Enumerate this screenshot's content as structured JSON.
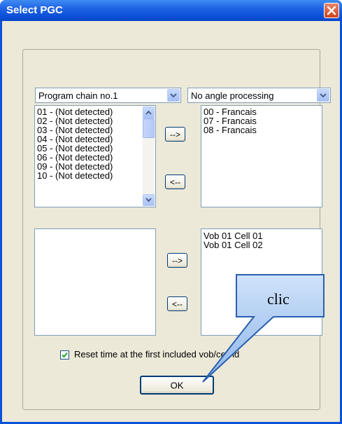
{
  "window": {
    "title": "Select PGC",
    "close_icon": "close-icon"
  },
  "combos": {
    "program_chain": "Program chain no.1",
    "angle": "No angle processing"
  },
  "audio_left": {
    "items": [
      "01 - (Not detected)",
      "02 - (Not detected)",
      "03 - (Not detected)",
      "04 - (Not detected)",
      "05 - (Not detected)",
      "06 - (Not detected)",
      "09 - (Not detected)",
      "10 - (Not detected)"
    ]
  },
  "audio_right": {
    "items": [
      "00 - Francais",
      "07 - Francais",
      "08 - Francais"
    ]
  },
  "cells_left": {
    "items": []
  },
  "cells_right": {
    "items": [
      "Vob 01 Cell 01",
      "Vob 01 Cell 02"
    ]
  },
  "buttons": {
    "add_audio": "-->",
    "remove_audio": "<--",
    "add_cell": "-->",
    "remove_cell": "<--",
    "ok": "OK"
  },
  "checkbox": {
    "label": "Reset time at the first included vob/cell id",
    "checked": true
  },
  "annotation": {
    "text": "clic"
  },
  "colors": {
    "titlebar": "#0a53d9",
    "dialog_bg": "#ece9d8",
    "callout_fill": "#a8c8f0"
  }
}
